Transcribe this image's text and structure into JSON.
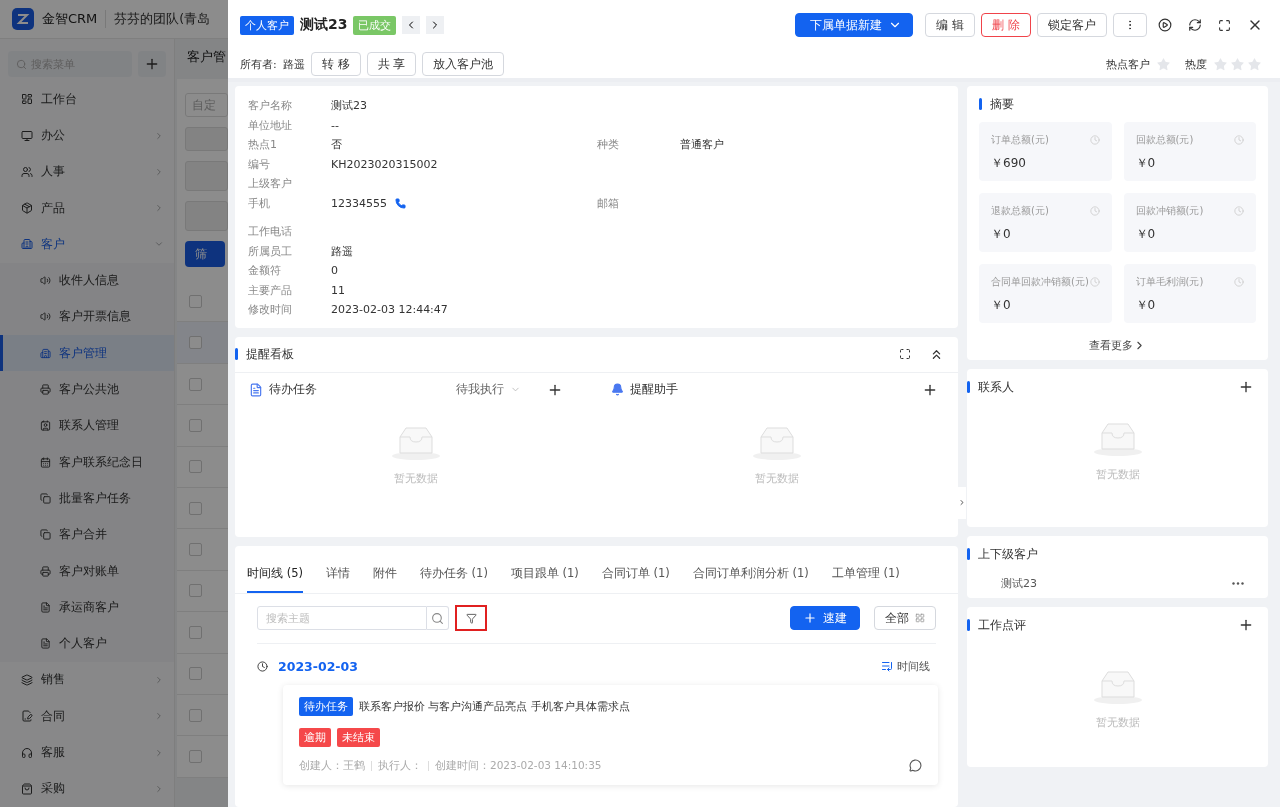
{
  "app": {
    "logo": "金智CRM",
    "team": "芬芬的团队(青岛"
  },
  "sidebar": {
    "search_placeholder": "搜索菜单",
    "items": [
      {
        "label": "工作台",
        "selected": false
      },
      {
        "label": "办公",
        "selected": false,
        "expanded": false
      },
      {
        "label": "人事",
        "selected": false,
        "expanded": false
      },
      {
        "label": "产品",
        "selected": false,
        "expanded": false
      },
      {
        "label": "客户",
        "selected": false,
        "expanded": true,
        "children": [
          {
            "label": "收件人信息",
            "selected": false
          },
          {
            "label": "客户开票信息",
            "selected": false
          },
          {
            "label": "客户管理",
            "selected": true
          },
          {
            "label": "客户公共池",
            "selected": false
          },
          {
            "label": "联系人管理",
            "selected": false
          },
          {
            "label": "客户联系纪念日",
            "selected": false
          },
          {
            "label": "批量客户任务",
            "selected": false
          },
          {
            "label": "客户合并",
            "selected": false
          },
          {
            "label": "客户对账单",
            "selected": false
          },
          {
            "label": "承运商客户",
            "selected": false
          },
          {
            "label": "个人客户",
            "selected": false
          }
        ]
      },
      {
        "label": "销售",
        "selected": false,
        "expanded": false
      },
      {
        "label": "合同",
        "selected": false,
        "expanded": false
      },
      {
        "label": "客服",
        "selected": false,
        "expanded": false
      },
      {
        "label": "采购",
        "selected": false,
        "expanded": false
      }
    ]
  },
  "page": {
    "title": "客户管",
    "filter_field": "自定",
    "filter_button": "筛",
    "rows": [
      {
        "checked": false
      },
      {
        "checked": false
      },
      {
        "checked": false
      },
      {
        "checked": false
      },
      {
        "checked": false
      },
      {
        "checked": false
      },
      {
        "checked": false
      },
      {
        "checked": false
      },
      {
        "checked": false
      },
      {
        "checked": false
      },
      {
        "checked": false
      },
      {
        "checked": false
      }
    ]
  },
  "drawer": {
    "type_tag": "个人客户",
    "title": "测试23",
    "status_tag": "已成交",
    "actions": [
      {
        "label": "下属单据新建",
        "kind": "primary"
      },
      {
        "label": "编 辑",
        "kind": "default"
      },
      {
        "label": "删 除",
        "kind": "danger"
      },
      {
        "label": "锁定客户",
        "kind": "default"
      }
    ],
    "owner_label": "所有者:",
    "owner": "路遥",
    "owner_actions": [
      "转 移",
      "共 享",
      "放入客户池"
    ],
    "hot_customer": {
      "label": "热点客户",
      "checked": false
    },
    "heat": {
      "label": "热度",
      "stars": 0
    },
    "info": [
      {
        "fields": [
          {
            "label": "客户名称",
            "value": "测试23"
          }
        ]
      },
      {
        "fields": [
          {
            "label": "单位地址",
            "value": "--"
          }
        ]
      },
      {
        "fields": [
          {
            "label": "热点1",
            "value": "否"
          },
          {
            "label": "种类",
            "value": "普通客户"
          }
        ]
      },
      {
        "fields": [
          {
            "label": "编号",
            "value": "KH2023020315002"
          }
        ]
      },
      {
        "fields": [
          {
            "label": "上级客户"
          }
        ]
      },
      {
        "fields": [
          {
            "label": "手机",
            "value": "12334555",
            "kind": "phone"
          },
          {
            "label": "邮箱"
          }
        ]
      },
      {
        "fields": [
          {
            "label": "工作电话"
          }
        ]
      },
      {
        "fields": [
          {
            "label": "所属员工",
            "value": "路遥"
          }
        ]
      },
      {
        "fields": [
          {
            "label": "金额符",
            "value": "0"
          }
        ]
      },
      {
        "fields": [
          {
            "label": "主要产品",
            "value": "11"
          }
        ]
      },
      {
        "fields": [
          {
            "label": "修改时间",
            "value": "2023-02-03 12:44:47"
          }
        ]
      }
    ],
    "reminder_board": {
      "title": "提醒看板",
      "panels": [
        {
          "title": "待办任务",
          "kind": "task",
          "filter": "待我执行",
          "empty": "暂无数据"
        },
        {
          "title": "提醒助手",
          "kind": "bell",
          "empty": "暂无数据"
        }
      ]
    },
    "timeline": {
      "tabs": [
        {
          "label": "时间线 (5)",
          "selected": true
        },
        {
          "label": "详情",
          "selected": false
        },
        {
          "label": "附件",
          "selected": false
        },
        {
          "label": "待办任务 (1)",
          "selected": false
        },
        {
          "label": "项目跟单 (1)",
          "selected": false
        },
        {
          "label": "合同订单 (1)",
          "selected": false
        },
        {
          "label": "合同订单利润分析 (1)",
          "selected": false
        },
        {
          "label": "工单管理 (1)",
          "selected": false
        }
      ],
      "search_placeholder": "搜索主题",
      "filter_highlighted": true,
      "quick_create": "速建",
      "scope": "全部",
      "date": "2023-02-03",
      "view_label": "时间线",
      "entry": {
        "tag": "待办任务",
        "title": "联系客户报价 与客户沟通产品亮点 手机客户具体需求点",
        "tags": [
          "逾期",
          "未结束"
        ],
        "creator": "创建人：王鹤",
        "executor": "执行人：",
        "created": "创建时间：2023-02-03 14:10:35"
      }
    },
    "summary": {
      "title": "摘要",
      "metrics": [
        {
          "label": "订单总额(元)",
          "value": "￥690"
        },
        {
          "label": "回款总额(元)",
          "value": "￥0"
        },
        {
          "label": "退款总额(元)",
          "value": "￥0"
        },
        {
          "label": "回款冲销额(元)",
          "value": "￥0"
        },
        {
          "label": "合同单回款冲销额(元)",
          "value": "￥0"
        },
        {
          "label": "订单毛利润(元)",
          "value": "￥0"
        }
      ],
      "more": "查看更多"
    },
    "contacts": {
      "title": "联系人",
      "empty": "暂无数据"
    },
    "hierarchy": {
      "title": "上下级客户",
      "items": [
        "测试23"
      ]
    },
    "review": {
      "title": "工作点评",
      "empty": "暂无数据"
    }
  }
}
